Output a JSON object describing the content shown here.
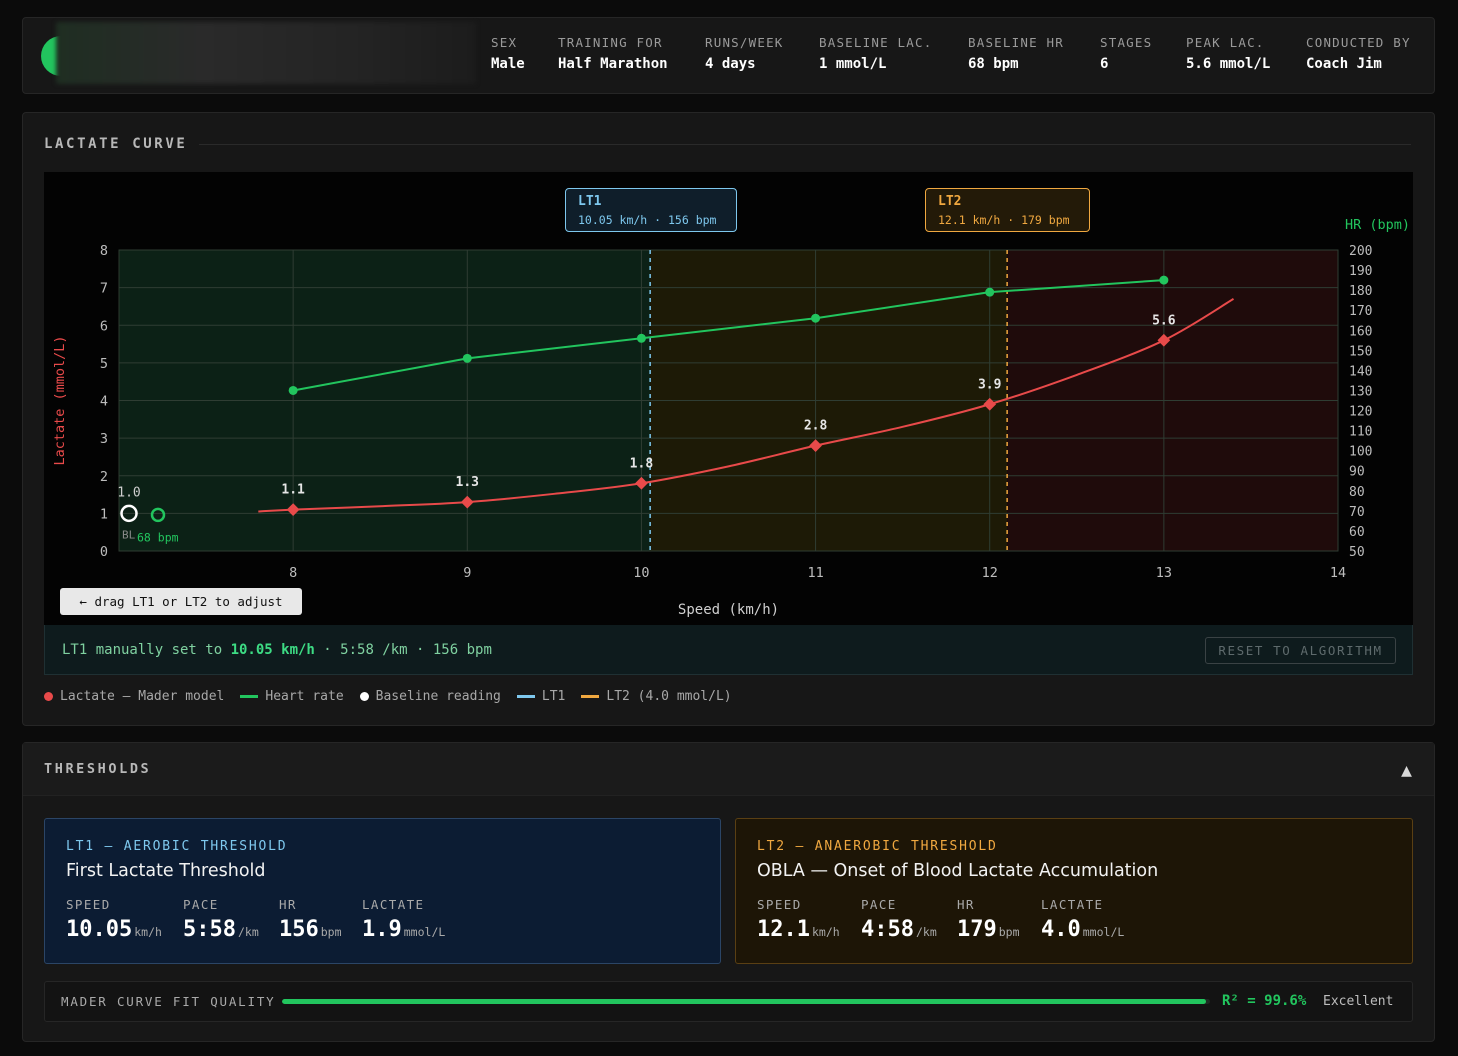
{
  "header": {
    "stats": [
      {
        "label": "SEX",
        "value": "Male"
      },
      {
        "label": "TRAINING FOR",
        "value": "Half Marathon"
      },
      {
        "label": "RUNS/WEEK",
        "value": "4 days"
      },
      {
        "label": "BASELINE LAC.",
        "value": "1 mmol/L"
      },
      {
        "label": "BASELINE HR",
        "value": "68 bpm"
      },
      {
        "label": "STAGES",
        "value": "6"
      },
      {
        "label": "PEAK LAC.",
        "value": "5.6 mmol/L"
      },
      {
        "label": "CONDUCTED BY",
        "value": "Coach Jim"
      }
    ]
  },
  "lactate_panel": {
    "title": "LACTATE CURVE",
    "lt1_box": {
      "title": "LT1",
      "subtitle": "10.05 km/h · 156 bpm"
    },
    "lt2_box": {
      "title": "LT2",
      "subtitle": "12.1 km/h · 179 bpm"
    },
    "drag_hint": "← drag LT1 or LT2 to adjust",
    "status": {
      "prefix": "LT1 manually set to ",
      "speed": "10.05 km/h",
      "suffix": " · 5:58 /km · 156 bpm"
    },
    "reset_label": "RESET TO ALGORITHM",
    "legend": [
      {
        "label": "Lactate — Mader model",
        "color": "#e84a4a",
        "icon": "dot"
      },
      {
        "label": "Heart rate",
        "color": "#22c55e",
        "icon": "dash"
      },
      {
        "label": "Baseline reading",
        "color": "#ffffff",
        "icon": "dot"
      },
      {
        "label": "LT1",
        "color": "#7ec8ee",
        "icon": "dash"
      },
      {
        "label": "LT2 (4.0 mmol/L)",
        "color": "#f0a840",
        "icon": "dash"
      }
    ]
  },
  "chart_data": {
    "type": "line",
    "xlabel": "Speed (km/h)",
    "ylabel": "Lactate (mmol/L)",
    "y2label": "HR (bpm)",
    "xlim": [
      7,
      14
    ],
    "ylim": [
      0,
      8
    ],
    "y2lim": [
      50,
      200
    ],
    "xticks": [
      8,
      9,
      10,
      11,
      12,
      13,
      14
    ],
    "yticks": [
      0,
      1,
      2,
      3,
      4,
      5,
      6,
      7,
      8
    ],
    "y2ticks": [
      50,
      60,
      70,
      80,
      90,
      100,
      110,
      120,
      130,
      140,
      150,
      160,
      170,
      180,
      190,
      200
    ],
    "grid": true,
    "series": [
      {
        "name": "Lactate — Mader model",
        "color": "#e84a4a",
        "points": [
          {
            "x": 8,
            "y": 1.1
          },
          {
            "x": 9,
            "y": 1.3
          },
          {
            "x": 10,
            "y": 1.8
          },
          {
            "x": 11,
            "y": 2.8
          },
          {
            "x": 12,
            "y": 3.9
          },
          {
            "x": 13,
            "y": 5.6
          }
        ],
        "labels": [
          "1.1",
          "1.3",
          "1.8",
          "2.8",
          "3.9",
          "5.6"
        ],
        "curve": [
          {
            "x": 7.8,
            "y": 1.05
          },
          {
            "x": 8,
            "y": 1.1
          },
          {
            "x": 8.5,
            "y": 1.19
          },
          {
            "x": 9,
            "y": 1.3
          },
          {
            "x": 9.5,
            "y": 1.52
          },
          {
            "x": 10,
            "y": 1.8
          },
          {
            "x": 10.5,
            "y": 2.25
          },
          {
            "x": 11,
            "y": 2.8
          },
          {
            "x": 11.5,
            "y": 3.3
          },
          {
            "x": 12,
            "y": 3.9
          },
          {
            "x": 12.5,
            "y": 4.68
          },
          {
            "x": 13,
            "y": 5.6
          },
          {
            "x": 13.4,
            "y": 6.7
          }
        ]
      },
      {
        "name": "Heart rate",
        "color": "#22c55e",
        "axis": "y2",
        "points": [
          {
            "x": 8,
            "y": 130
          },
          {
            "x": 9,
            "y": 146
          },
          {
            "x": 10,
            "y": 156
          },
          {
            "x": 11,
            "y": 166
          },
          {
            "x": 12,
            "y": 179
          },
          {
            "x": 13,
            "y": 185
          }
        ]
      }
    ],
    "baseline": {
      "lactate_label": "1.0",
      "lactate": 1.0,
      "hr": 68,
      "bl_label": "BL",
      "hr_label": "68 bpm"
    },
    "thresholds": {
      "lt1_x": 10.05,
      "lt2_x": 12.1
    },
    "zones": [
      {
        "from": 7,
        "to": 10.05,
        "color": "#0c2116"
      },
      {
        "from": 10.05,
        "to": 12.1,
        "color": "#1d1a06"
      },
      {
        "from": 12.1,
        "to": 14,
        "color": "#1f0b0b"
      }
    ]
  },
  "thresholds_panel": {
    "title": "THRESHOLDS",
    "lt1": {
      "kicker": "LT1 — AEROBIC THRESHOLD",
      "title": "First Lactate Threshold",
      "speed_label": "SPEED",
      "speed": "10.05",
      "speed_unit": "km/h",
      "pace_label": "PACE",
      "pace": "5:58",
      "pace_unit": "/km",
      "hr_label": "HR",
      "hr": "156",
      "hr_unit": "bpm",
      "lactate_label": "LACTATE",
      "lactate": "1.9",
      "lactate_unit": "mmol/L"
    },
    "lt2": {
      "kicker": "LT2 — ANAEROBIC THRESHOLD",
      "title": "OBLA — Onset of Blood Lactate Accumulation",
      "speed_label": "SPEED",
      "speed": "12.1",
      "speed_unit": "km/h",
      "pace_label": "PACE",
      "pace": "4:58",
      "pace_unit": "/km",
      "hr_label": "HR",
      "hr": "179",
      "hr_unit": "bpm",
      "lactate_label": "LACTATE",
      "lactate": "4.0",
      "lactate_unit": "mmol/L"
    },
    "fit": {
      "label": "MADER CURVE FIT QUALITY",
      "r2_text": "R² = 99.6%",
      "r2": 0.996,
      "quality": "Excellent"
    }
  }
}
